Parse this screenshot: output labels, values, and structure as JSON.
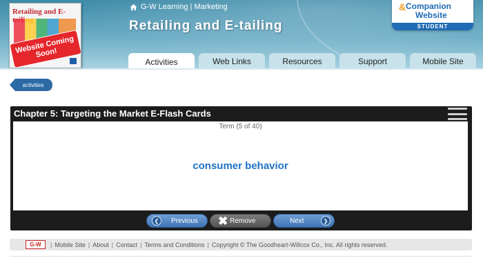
{
  "header": {
    "breadcrumb": "G-W Learning | Marketing",
    "title": "Retailing and E-tailing",
    "book_cover": {
      "title": "Retailing and E-tailing",
      "stamp": "Website Coming Soon!"
    },
    "companion": {
      "line1": "Companion",
      "line2": "Website",
      "badge": "STUDENT"
    }
  },
  "tabs": [
    {
      "label": "Activities",
      "active": true
    },
    {
      "label": "Web Links",
      "active": false
    },
    {
      "label": "Resources",
      "active": false
    },
    {
      "label": "Support",
      "active": false
    },
    {
      "label": "Mobile Site",
      "active": false
    }
  ],
  "back_button": {
    "label": "activities"
  },
  "flashcards": {
    "title": "Chapter 5: Targeting the Market E-Flash Cards",
    "counter": "Term (5 of 40)",
    "term": "consumer behavior",
    "previous_label": "Previous",
    "remove_label": "Remove",
    "next_label": "Next"
  },
  "footer": {
    "logo": "G-W",
    "links": [
      "Mobile Site",
      "About",
      "Contact",
      "Terms and Conditions"
    ],
    "copyright": "Copyright © The Goodheart-Willcox Co., Inc. All rights reserved."
  },
  "colors": {
    "header_blue": "#3f8ca9",
    "tab_inactive": "#c7e2ea",
    "term_blue": "#1f73c4",
    "panel_dark": "#1c1c1c"
  }
}
